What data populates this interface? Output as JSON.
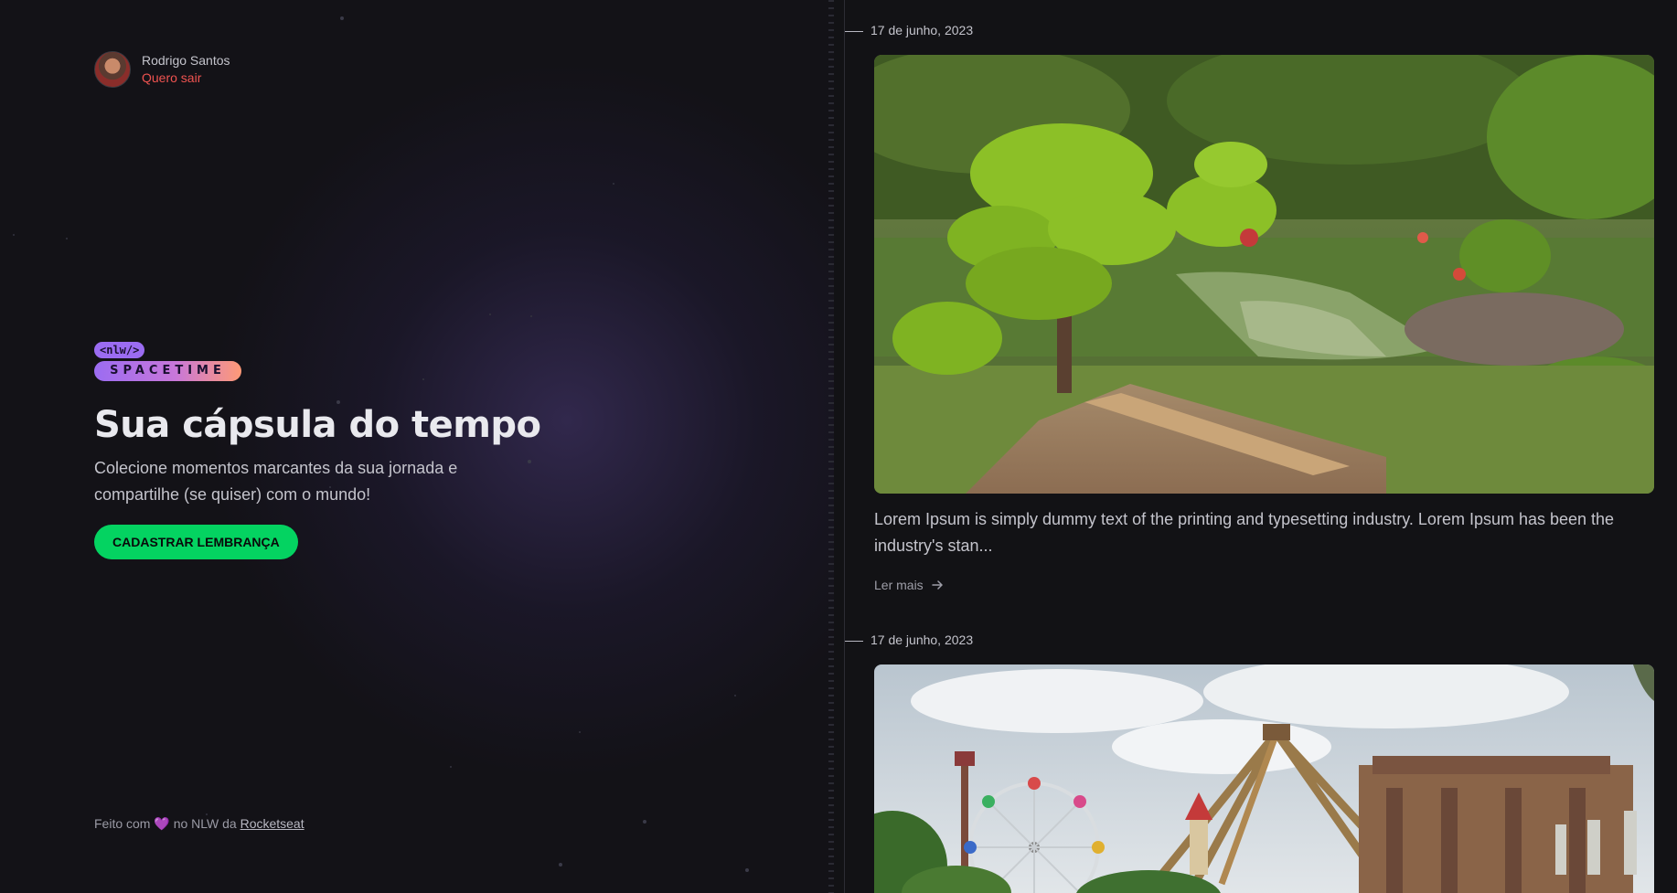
{
  "user": {
    "name": "Rodrigo Santos",
    "logout_label": "Quero sair"
  },
  "logo": {
    "top_text": "<nlw/>",
    "bottom_text": "SPACETIME"
  },
  "hero": {
    "title": "Sua cápsula do tempo",
    "subtitle": "Colecione momentos marcantes da sua jornada e compartilhe (se quiser) com o mundo!",
    "cta_label": "CADASTRAR LEMBRANÇA"
  },
  "footer": {
    "prefix": "Feito com",
    "heart": "💜",
    "middle": "no NLW da",
    "link_label": "Rocketseat"
  },
  "memories": [
    {
      "date": "17 de junho, 2023",
      "excerpt": "Lorem Ipsum is simply dummy text of the printing and typesetting industry. Lorem Ipsum has been the industry's stan...",
      "read_more_label": "Ler mais",
      "image_subject": "garden with topiary trees and pond"
    },
    {
      "date": "17 de junho, 2023",
      "image_subject": "amusement park with ferris wheel and pendulum ride"
    }
  ],
  "colors": {
    "background": "#121215",
    "accent_green": "#04d361",
    "logout_red": "#ef5350",
    "brand_purple": "#9b6cf2",
    "brand_orange": "#ff9a76"
  },
  "icons": {
    "read_more": "arrow-right-icon"
  }
}
